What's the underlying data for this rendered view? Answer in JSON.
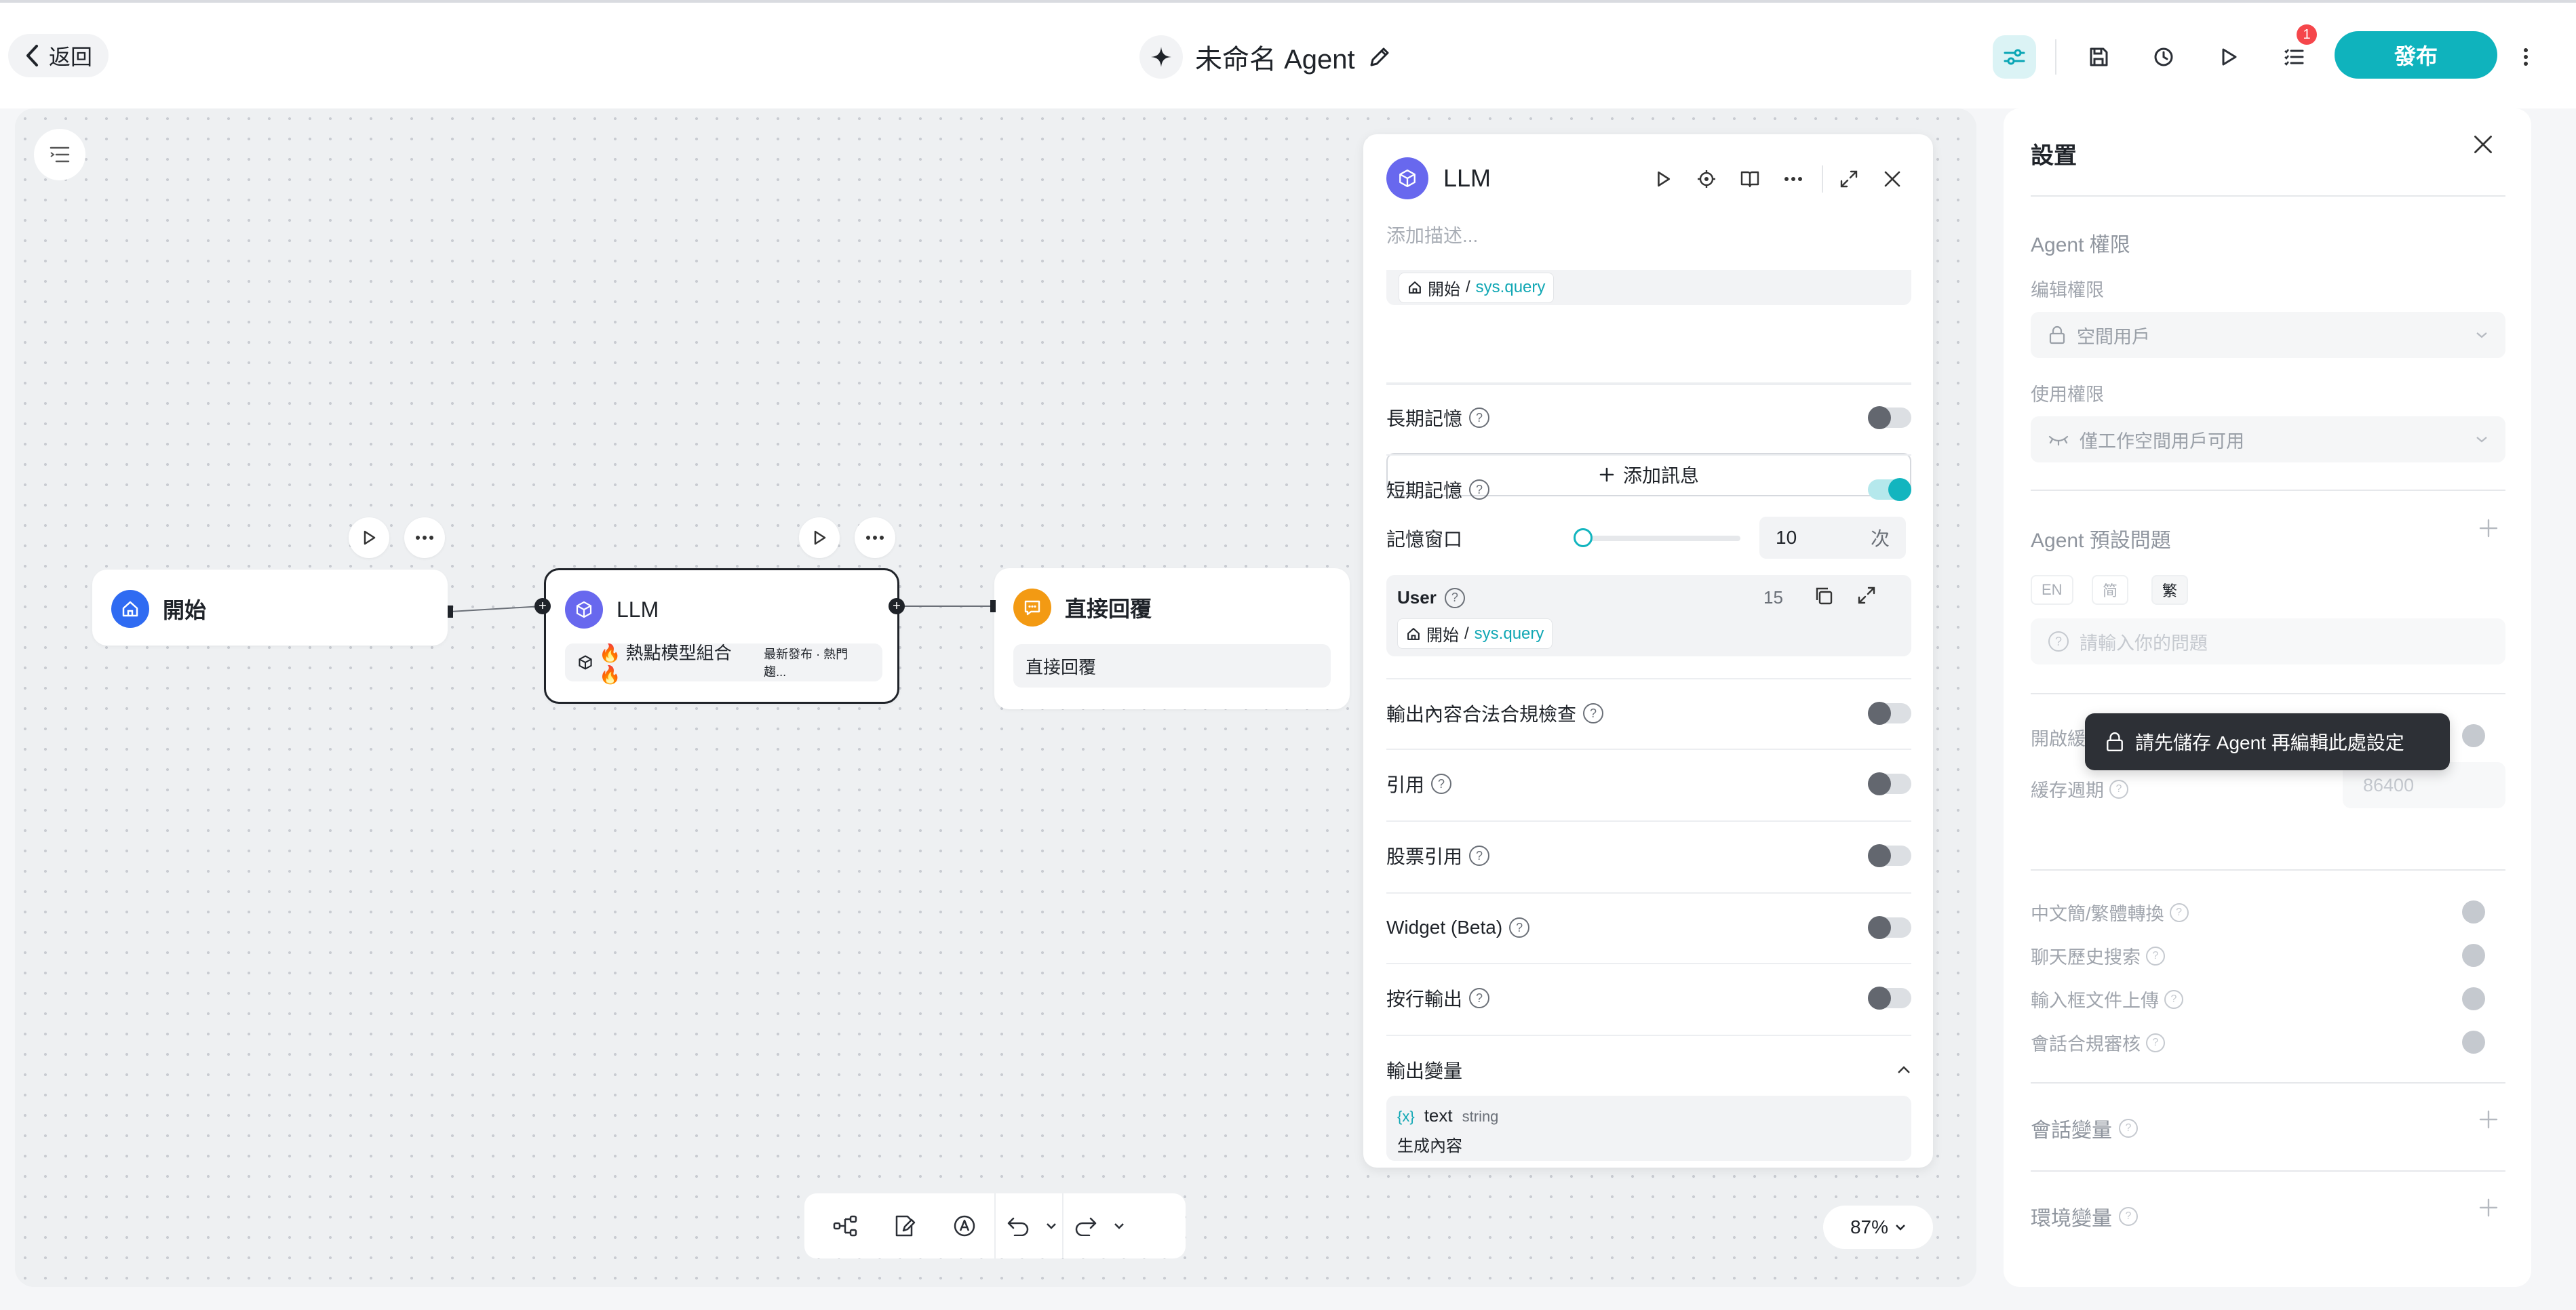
{
  "header": {
    "back_label": "返回",
    "title": "未命名 Agent",
    "publish_label": "發布",
    "notification_count": "1"
  },
  "canvas": {
    "zoom": "87%",
    "nodes": {
      "start": {
        "label": "開始"
      },
      "llm": {
        "label": "LLM",
        "model": "🔥 熱點模型組合 🔥",
        "model_tag": "最新發布 · 熱門趨..."
      },
      "reply": {
        "label": "直接回覆",
        "content": "直接回覆"
      }
    }
  },
  "llm_panel": {
    "title": "LLM",
    "description_placeholder": "添加描述...",
    "input_source": {
      "node": "開始",
      "sep": "/",
      "var": "sys.query"
    },
    "add_message_label": "添加訊息",
    "long_memory_label": "長期記憶",
    "short_memory_label": "短期記憶",
    "memory_window_label": "記憶窗口",
    "memory_window_value": "10",
    "memory_window_unit": "次",
    "memory_window_fraction": 0.0,
    "user_block": {
      "role": "User",
      "count": "15",
      "node": "開始",
      "sep": "/",
      "var": "sys.query"
    },
    "toggles": [
      {
        "label": "輸出內容合法合規檢查",
        "on": false
      },
      {
        "label": "引用",
        "on": false
      },
      {
        "label": "股票引用",
        "on": false
      },
      {
        "label": "Widget (Beta)",
        "on": false
      },
      {
        "label": "按行輸出",
        "on": false
      }
    ],
    "output_vars_label": "輸出變量",
    "output_var": {
      "icon_text": "{x}",
      "name": "text",
      "type": "string",
      "desc": "生成內容"
    }
  },
  "settings": {
    "title": "設置",
    "agent_permission_label": "Agent 權限",
    "edit_permission_label": "编辑權限",
    "edit_permission_value": "空間用戶",
    "use_permission_label": "使用權限",
    "use_permission_value": "僅工作空間用戶可用",
    "preset_questions_label": "Agent 預設問題",
    "languages": [
      "EN",
      "简",
      "繁"
    ],
    "question_placeholder": "請輸入你的問題",
    "cache_label": "開啟緩",
    "cache_period_label": "緩存週期",
    "cache_period_value": "86400",
    "tooltip": "請先儲存 Agent 再編輯此處設定",
    "features": [
      {
        "label": "中文簡/繁體轉換"
      },
      {
        "label": "聊天歷史搜索"
      },
      {
        "label": "輸入框文件上傳"
      },
      {
        "label": "會話合規審核"
      }
    ],
    "session_vars_label": "會話變量",
    "env_vars_label": "環境變量"
  },
  "colors": {
    "accent": "#0fb3bd",
    "start_node": "#2f6bf2",
    "llm_node": "#6868ee",
    "reply_node": "#f39a13"
  }
}
